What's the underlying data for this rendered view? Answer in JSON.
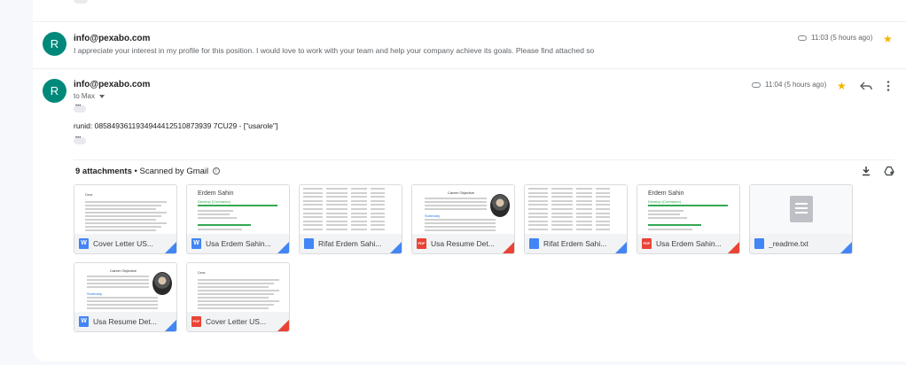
{
  "messages": [
    {
      "avatar_letter": "R",
      "sender": "info@pexabo.com",
      "snippet": "I appreciate your interest in my profile for this position. I would love to work with your team and help your company achieve its goals. Please find attached so",
      "time": "11:03 (5 hours ago)",
      "starred": true
    },
    {
      "avatar_letter": "R",
      "sender": "info@pexabo.com",
      "to": "to Max",
      "time": "11:04 (5 hours ago)",
      "starred": true,
      "body": "runid: 0858493611934944412510873939 7CU29 - [\"usarole\"]"
    }
  ],
  "attachments": {
    "count_label": "9 attachments",
    "scanned_label": "• Scanned by Gmail",
    "files": [
      {
        "name": "Cover Letter US...",
        "type": "word",
        "icon_letter": "W"
      },
      {
        "name": "Usa Erdem Sahin...",
        "type": "word",
        "icon_letter": "W"
      },
      {
        "name": "Rifat Erdem Sahi...",
        "type": "docs",
        "icon_letter": ""
      },
      {
        "name": "Usa Resume Det...",
        "type": "pdf",
        "icon_letter": "PDF"
      },
      {
        "name": "Rifat Erdem Sahi...",
        "type": "docs",
        "icon_letter": ""
      },
      {
        "name": "Usa Erdem Sahin...",
        "type": "pdf",
        "icon_letter": "PDF"
      },
      {
        "name": "_readme.txt",
        "type": "docs",
        "icon_letter": ""
      },
      {
        "name": "Usa Resume Det...",
        "type": "word",
        "icon_letter": "W"
      },
      {
        "name": "Cover Letter US...",
        "type": "pdf",
        "icon_letter": "PDF"
      }
    ],
    "thumb_text": {
      "erdem_name": "Erdem Sahin",
      "erdem_role": "Develop (Contractor)",
      "cover_heading": "Dear",
      "resume_objective": "Career Objective",
      "resume_summary": "Summary"
    }
  },
  "colors": {
    "avatar": "#00897b",
    "star": "#f4b400",
    "word": "#4285f4",
    "pdf": "#ea4335",
    "docs": "#4285f4",
    "erdem_green": "#34a853"
  },
  "icons": [
    "attachment-icon",
    "star-icon",
    "reply-icon",
    "more-vert-icon",
    "info-icon",
    "download-all-icon",
    "add-to-drive-icon"
  ]
}
